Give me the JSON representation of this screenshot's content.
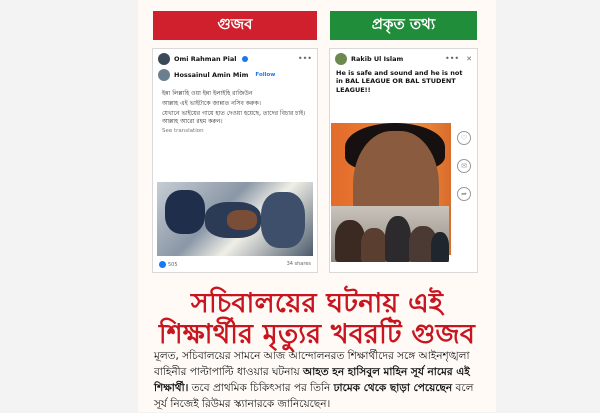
{
  "labels": {
    "rumor": "গুজব",
    "fact": "প্রকৃত তথ্য"
  },
  "left_post": {
    "author": "Omi Rahman Pial",
    "shared_author": "Hossainul Amin Mim",
    "follow": "Follow",
    "lines": [
      "ইন্না লিল্লাহি ওয়া ইন্না ইলাইহি রাজিউন",
      "আল্লাহ এই ভাইটাকে জান্নাত নসিব করুক।",
      "যেখানে ভাইয়ের গায়ে হাত দেওয়া হয়েছে, তাদের বিচার চাই। আল্লাহ আরো রহম করুন।"
    ],
    "see_translation": "See translation",
    "reactions": "505",
    "shares": "34 shares"
  },
  "right_post": {
    "author": "Rakib Ul Islam",
    "caption": "He is safe and sound and he is not in BAL LEAGUE OR BAL STUDENT LEAGUE!!"
  },
  "headline": {
    "line1": "সচিবালয়ের ঘটনায় এই",
    "line2": "শিক্ষার্থীর মৃত্যুর খবরটি গুজব"
  },
  "body": {
    "part1": "মূলত, সচিবালয়ের সামনে আজ আন্দোলনরত শিক্ষার্থীদের সঙ্গে আইনশৃঙ্খলা বাহিনীর পাল্টাপাল্টি ধাওয়ার ঘটনায় ",
    "bold1": "আহত হন হাসিবুল মাহিন সূর্য নামের এই শিক্ষার্থী।",
    "part2": " তবে প্রাথমিক চিকিৎসার পর তিনি ",
    "bold2": "ঢামেক থেকে ছাড়া পেয়েছেন",
    "part3": " বলে সূর্য নিজেই রিউমর স্ক্যানারকে জানিয়েছেন।"
  },
  "colors": {
    "rumor": "#d0202d",
    "fact": "#1f8d3a",
    "headline": "#c8151f"
  }
}
